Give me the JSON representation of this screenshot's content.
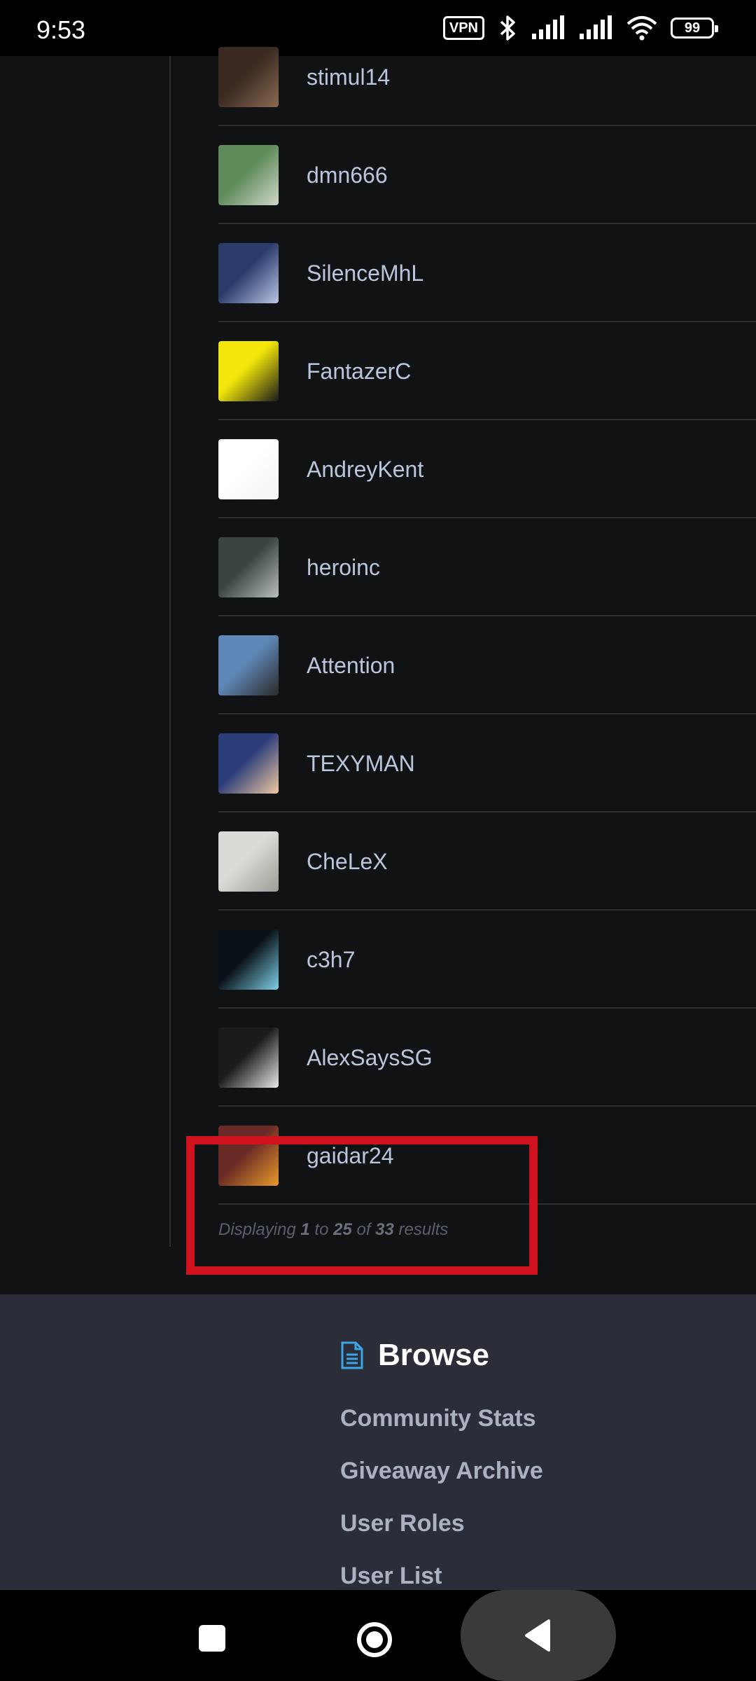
{
  "status_bar": {
    "time": "9:53",
    "vpn_label": "VPN",
    "battery_level": "99"
  },
  "users": [
    {
      "name": "stimul14",
      "avatar_colors": [
        "#3b2a22",
        "#8a6a50"
      ]
    },
    {
      "name": "dmn666",
      "avatar_colors": [
        "#5e8a5a",
        "#cfd8c8"
      ]
    },
    {
      "name": "SilenceMhL",
      "avatar_colors": [
        "#2a3a6a",
        "#b9c6e4"
      ]
    },
    {
      "name": "FantazerC",
      "avatar_colors": [
        "#f2e60a",
        "#1a1a1a"
      ]
    },
    {
      "name": "AndreyKent",
      "avatar_colors": [
        "#ffffff",
        "#f4f4f4"
      ]
    },
    {
      "name": "heroinc",
      "avatar_colors": [
        "#3a4442",
        "#b8c0bc"
      ]
    },
    {
      "name": "Attention",
      "avatar_colors": [
        "#5f87b8",
        "#2b2a28"
      ]
    },
    {
      "name": "TEXYMAN",
      "avatar_colors": [
        "#2c3e7a",
        "#f0c8a0"
      ]
    },
    {
      "name": "CheLeX",
      "avatar_colors": [
        "#d9dbd6",
        "#9a9e96"
      ]
    },
    {
      "name": "c3h7",
      "avatar_colors": [
        "#0a1218",
        "#7fd0e8"
      ]
    },
    {
      "name": "AlexSaysSG",
      "avatar_colors": [
        "#1a1a1a",
        "#e8e8e8"
      ]
    },
    {
      "name": "gaidar24",
      "avatar_colors": [
        "#6a2a26",
        "#e89a2a"
      ]
    }
  ],
  "pagination": {
    "prefix": "Displaying",
    "from": "1",
    "to_word": "to",
    "to": "25",
    "of_word": "of",
    "total": "33",
    "suffix": "results"
  },
  "footer": {
    "section_title": "Browse",
    "links": [
      "Community Stats",
      "Giveaway Archive",
      "User Roles",
      "User List"
    ]
  },
  "accent_colors": {
    "highlight": "#d0121e",
    "browse_icon": "#3aa6e8"
  }
}
